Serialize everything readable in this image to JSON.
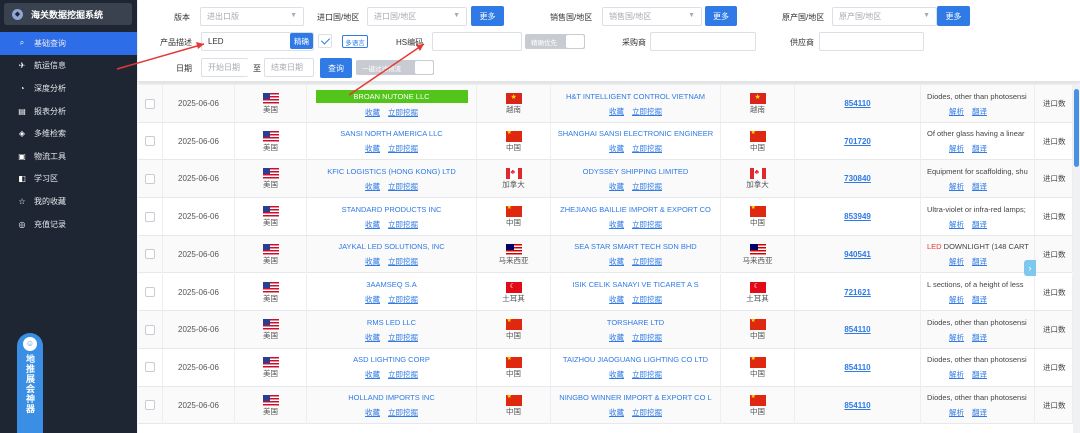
{
  "app": {
    "title": "海关数据挖掘系统"
  },
  "sidebar": {
    "items": [
      {
        "label": "基础查询",
        "icon": "search-icon",
        "glyph": "⌕",
        "active": true
      },
      {
        "label": "航运信息",
        "icon": "plane-icon",
        "glyph": "✈",
        "active": false
      },
      {
        "label": "深度分析",
        "icon": "analysis-icon",
        "glyph": "◔",
        "active": false
      },
      {
        "label": "报表分析",
        "icon": "chart-icon",
        "glyph": "▤",
        "active": false
      },
      {
        "label": "多维检索",
        "icon": "filter-icon",
        "glyph": "◈",
        "active": false
      },
      {
        "label": "物流工具",
        "icon": "box-icon",
        "glyph": "▣",
        "active": false
      },
      {
        "label": "学习区",
        "icon": "study-icon",
        "glyph": "◧",
        "active": false
      },
      {
        "label": "我的收藏",
        "icon": "star-icon",
        "glyph": "☆",
        "active": false
      },
      {
        "label": "充值记录",
        "icon": "recharge-icon",
        "glyph": "◎",
        "active": false
      }
    ],
    "promo": {
      "label": "地推展会神器"
    }
  },
  "filters": {
    "version": {
      "label": "版本",
      "placeholder": "进出口版"
    },
    "import_country": {
      "label": "进口国/地区",
      "placeholder": "进口国/地区",
      "more": "更多"
    },
    "sales_country": {
      "label": "销售国/地区",
      "placeholder": "销售国/地区",
      "more": "更多"
    },
    "origin_country": {
      "label": "原产国/地区",
      "placeholder": "原产国/地区",
      "more": "更多"
    },
    "product_desc": {
      "label": "产品描述",
      "value": "LED",
      "exact": "精确",
      "multilang": "多语言"
    },
    "hs_code": {
      "label": "HS编码",
      "value": "",
      "precise_first": "精确优先"
    },
    "buyer": {
      "label": "采购商",
      "value": ""
    },
    "supplier": {
      "label": "供应商",
      "value": ""
    },
    "date": {
      "label": "日期",
      "start_placeholder": "开始日期",
      "sep": "至",
      "end_placeholder": "结束日期"
    },
    "search_button": "查询",
    "filter_toggle": "一键过滤物流"
  },
  "table": {
    "rows": [
      {
        "date": "2025-06-06",
        "buyer_flag": "us",
        "buyer_country": "美国",
        "buyer": "BROAN NUTONE LLC",
        "buyer_highlight": true,
        "seller_flag": "vn",
        "seller_country": "越南",
        "seller": "H&T INTELLIGENT CONTROL VIETNAM",
        "origin_flag": "vn",
        "origin_country": "越南",
        "hs": "854110",
        "desc": "Diodes, other than photosensi",
        "desc_red": "",
        "type": "进口数"
      },
      {
        "date": "2025-06-06",
        "buyer_flag": "us",
        "buyer_country": "美国",
        "buyer": "SANSI NORTH AMERICA LLC",
        "buyer_highlight": false,
        "seller_flag": "cn",
        "seller_country": "中国",
        "seller": "SHANGHAI SANSI ELECTRONIC ENGINEER",
        "origin_flag": "cn",
        "origin_country": "中国",
        "hs": "701720",
        "desc": "Of other glass having a linear",
        "desc_red": "",
        "type": "进口数"
      },
      {
        "date": "2025-06-06",
        "buyer_flag": "us",
        "buyer_country": "美国",
        "buyer": "KFIC LOGISTICS (HONG KONG) LTD",
        "buyer_highlight": false,
        "seller_flag": "ca",
        "seller_country": "加拿大",
        "seller": "ODYSSEY SHIPPING LIMITED",
        "origin_flag": "ca",
        "origin_country": "加拿大",
        "hs": "730840",
        "desc": "Equipment for scaffolding, shu",
        "desc_red": "",
        "type": "进口数"
      },
      {
        "date": "2025-06-06",
        "buyer_flag": "us",
        "buyer_country": "美国",
        "buyer": "STANDARD PRODUCTS INC",
        "buyer_highlight": false,
        "seller_flag": "cn",
        "seller_country": "中国",
        "seller": "ZHEJIANG BAILLIE IMPORT & EXPORT CO",
        "origin_flag": "cn",
        "origin_country": "中国",
        "hs": "853949",
        "desc": "Ultra-violet or infra-red lamps;",
        "desc_red": "",
        "type": "进口数"
      },
      {
        "date": "2025-06-06",
        "buyer_flag": "us",
        "buyer_country": "美国",
        "buyer": "JAYKAL LED SOLUTIONS, INC",
        "buyer_highlight": false,
        "seller_flag": "my",
        "seller_country": "马来西亚",
        "seller": "SEA STAR SMART TECH SDN BHD",
        "origin_flag": "my",
        "origin_country": "马来西亚",
        "hs": "940541",
        "desc": " DOWNLIGHT (148 CART",
        "desc_red": "LED",
        "type": "进口数"
      },
      {
        "date": "2025-06-06",
        "buyer_flag": "us",
        "buyer_country": "美国",
        "buyer": "3AAMSEQ S.A",
        "buyer_highlight": false,
        "seller_flag": "tr",
        "seller_country": "土耳其",
        "seller": "ISIK CELIK SANAYI VE TICARET A S",
        "origin_flag": "tr",
        "origin_country": "土耳其",
        "hs": "721621",
        "desc": "L sections, of a height of less",
        "desc_red": "",
        "type": "进口数"
      },
      {
        "date": "2025-06-06",
        "buyer_flag": "us",
        "buyer_country": "美国",
        "buyer": "RMS LED LLC",
        "buyer_highlight": false,
        "seller_flag": "cn",
        "seller_country": "中国",
        "seller": "TORSHARE LTD",
        "origin_flag": "cn",
        "origin_country": "中国",
        "hs": "854110",
        "desc": "Diodes, other than photosensi",
        "desc_red": "",
        "type": "进口数"
      },
      {
        "date": "2025-06-06",
        "buyer_flag": "us",
        "buyer_country": "美国",
        "buyer": "ASD LIGHTING CORP",
        "buyer_highlight": false,
        "seller_flag": "cn",
        "seller_country": "中国",
        "seller": "TAIZHOU JIAOGUANG LIGHTING CO LTD",
        "origin_flag": "cn",
        "origin_country": "中国",
        "hs": "854110",
        "desc": "Diodes, other than photosensi",
        "desc_red": "",
        "type": "进口数"
      },
      {
        "date": "2025-06-06",
        "buyer_flag": "us",
        "buyer_country": "美国",
        "buyer": "HOLLAND IMPORTS INC",
        "buyer_highlight": false,
        "seller_flag": "cn",
        "seller_country": "中国",
        "seller": "NINGBO WINNER IMPORT & EXPORT CO L",
        "origin_flag": "cn",
        "origin_country": "中国",
        "hs": "854110",
        "desc": "Diodes, other than photosensi",
        "desc_red": "",
        "type": "进口数"
      }
    ],
    "buyer_actions": [
      "收藏",
      "立即挖掘"
    ],
    "desc_actions": [
      "解析",
      "翻译"
    ]
  },
  "colors": {
    "accent": "#2f7ae5",
    "highlight": "#52c41a",
    "annotation": "#e53935",
    "sidebar_bg": "#1f2633"
  }
}
